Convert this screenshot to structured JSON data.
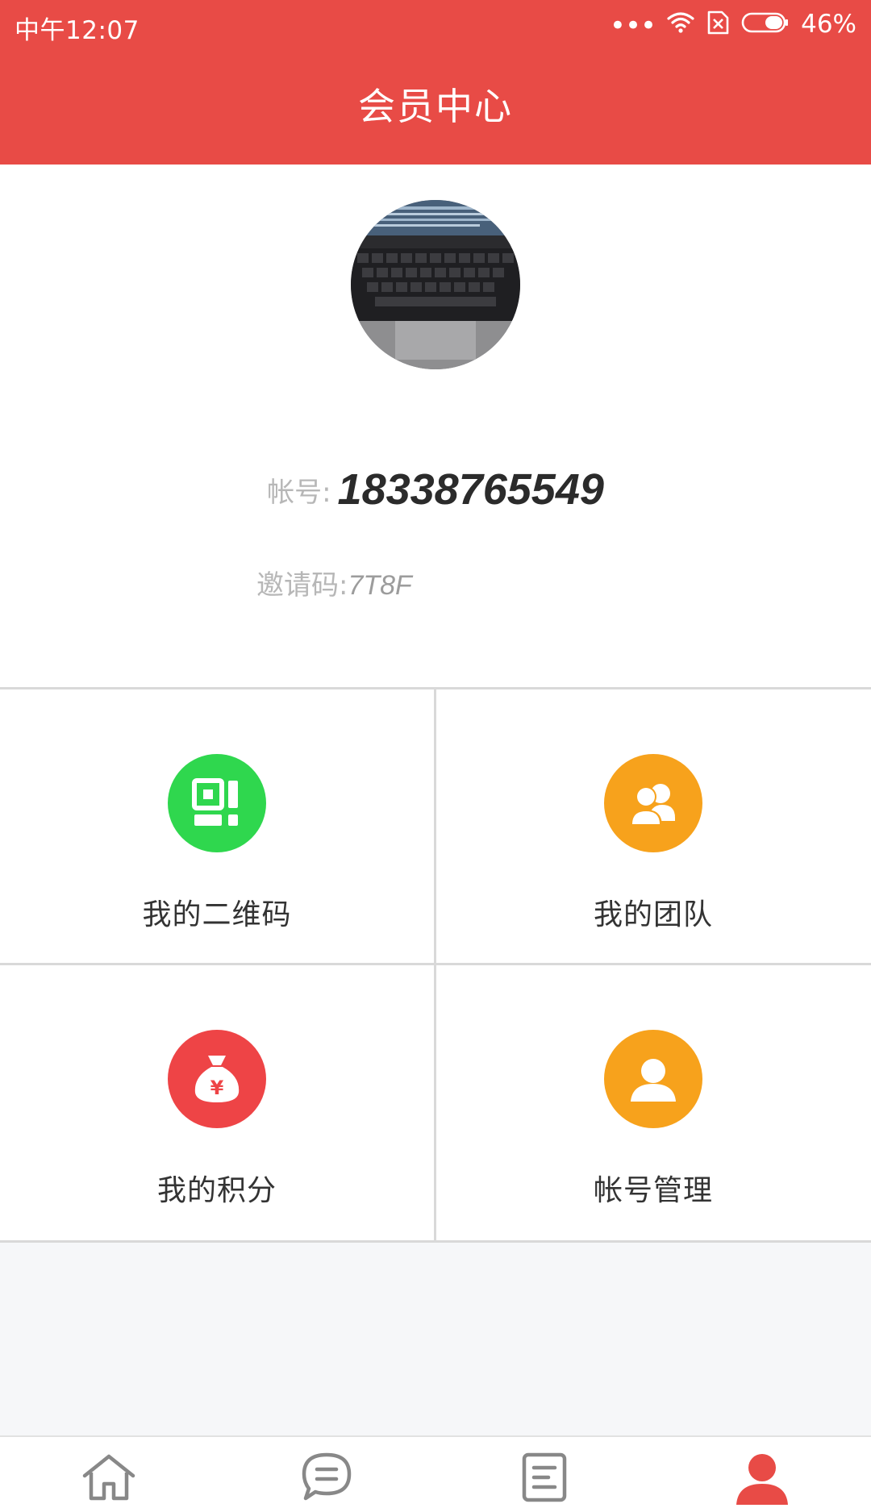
{
  "status_bar": {
    "time": "中午12:07",
    "dots": "•••",
    "battery": "46%"
  },
  "header": {
    "title": "会员中心"
  },
  "profile": {
    "account_label": "帐号:",
    "account_value": "18338765549",
    "invite_label": "邀请码:",
    "invite_value": "7T8F"
  },
  "grid": {
    "items": [
      {
        "label": "我的二维码",
        "icon": "qr-code-icon",
        "color": "#2fd74e"
      },
      {
        "label": "我的团队",
        "icon": "team-icon",
        "color": "#f7a21c"
      },
      {
        "label": "我的积分",
        "icon": "money-bag-icon",
        "color": "#ee4446"
      },
      {
        "label": "帐号管理",
        "icon": "person-icon",
        "color": "#f7a21c"
      }
    ]
  },
  "bottom_nav": {
    "items": [
      {
        "icon": "home-icon",
        "active": false
      },
      {
        "icon": "chat-icon",
        "active": false
      },
      {
        "icon": "document-icon",
        "active": false
      },
      {
        "icon": "profile-icon",
        "active": true
      }
    ],
    "active_color": "#e84b46",
    "inactive_color": "#888888"
  },
  "colors": {
    "primary": "#e84b46"
  }
}
